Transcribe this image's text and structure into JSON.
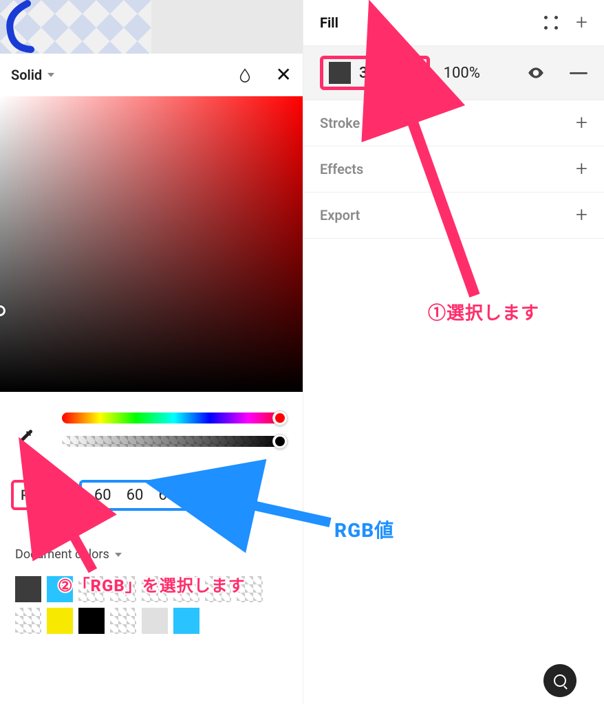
{
  "picker": {
    "fill_type": "Solid",
    "color_mode": "RGB",
    "rgb": {
      "r": "60",
      "g": "60",
      "b": "60"
    },
    "alpha": "100%",
    "document_colors_label": "Document colors",
    "swatches": [
      "#3c3c3c",
      "#29c3ff",
      "checker",
      "checker",
      "checker",
      "checker",
      "checker",
      "checker",
      "checker",
      "#f7e900",
      "#000000",
      "checker",
      "#e0e0e0",
      "#29c3ff"
    ]
  },
  "panel": {
    "fill": {
      "label": "Fill",
      "hex": "3C3C3C",
      "opacity": "100%"
    },
    "stroke_label": "Stroke",
    "effects_label": "Effects",
    "export_label": "Export"
  },
  "annotations": {
    "step1": "①選択します",
    "step2": "②「RGB」を選択します",
    "rgb_label": "RGB値"
  }
}
